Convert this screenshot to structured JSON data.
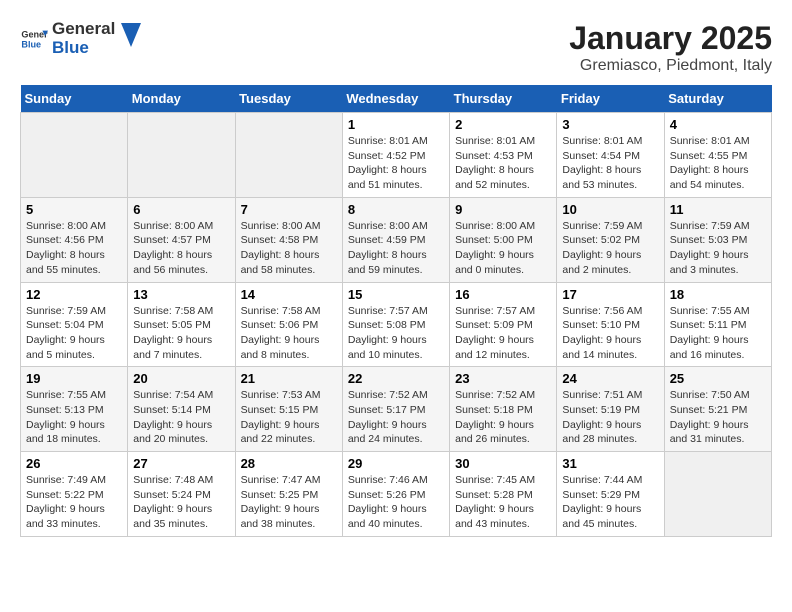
{
  "header": {
    "logo_general": "General",
    "logo_blue": "Blue",
    "title": "January 2025",
    "subtitle": "Gremiasco, Piedmont, Italy"
  },
  "days_of_week": [
    "Sunday",
    "Monday",
    "Tuesday",
    "Wednesday",
    "Thursday",
    "Friday",
    "Saturday"
  ],
  "weeks": [
    [
      {
        "day": "",
        "info": ""
      },
      {
        "day": "",
        "info": ""
      },
      {
        "day": "",
        "info": ""
      },
      {
        "day": "1",
        "info": "Sunrise: 8:01 AM\nSunset: 4:52 PM\nDaylight: 8 hours and 51 minutes."
      },
      {
        "day": "2",
        "info": "Sunrise: 8:01 AM\nSunset: 4:53 PM\nDaylight: 8 hours and 52 minutes."
      },
      {
        "day": "3",
        "info": "Sunrise: 8:01 AM\nSunset: 4:54 PM\nDaylight: 8 hours and 53 minutes."
      },
      {
        "day": "4",
        "info": "Sunrise: 8:01 AM\nSunset: 4:55 PM\nDaylight: 8 hours and 54 minutes."
      }
    ],
    [
      {
        "day": "5",
        "info": "Sunrise: 8:00 AM\nSunset: 4:56 PM\nDaylight: 8 hours and 55 minutes."
      },
      {
        "day": "6",
        "info": "Sunrise: 8:00 AM\nSunset: 4:57 PM\nDaylight: 8 hours and 56 minutes."
      },
      {
        "day": "7",
        "info": "Sunrise: 8:00 AM\nSunset: 4:58 PM\nDaylight: 8 hours and 58 minutes."
      },
      {
        "day": "8",
        "info": "Sunrise: 8:00 AM\nSunset: 4:59 PM\nDaylight: 8 hours and 59 minutes."
      },
      {
        "day": "9",
        "info": "Sunrise: 8:00 AM\nSunset: 5:00 PM\nDaylight: 9 hours and 0 minutes."
      },
      {
        "day": "10",
        "info": "Sunrise: 7:59 AM\nSunset: 5:02 PM\nDaylight: 9 hours and 2 minutes."
      },
      {
        "day": "11",
        "info": "Sunrise: 7:59 AM\nSunset: 5:03 PM\nDaylight: 9 hours and 3 minutes."
      }
    ],
    [
      {
        "day": "12",
        "info": "Sunrise: 7:59 AM\nSunset: 5:04 PM\nDaylight: 9 hours and 5 minutes."
      },
      {
        "day": "13",
        "info": "Sunrise: 7:58 AM\nSunset: 5:05 PM\nDaylight: 9 hours and 7 minutes."
      },
      {
        "day": "14",
        "info": "Sunrise: 7:58 AM\nSunset: 5:06 PM\nDaylight: 9 hours and 8 minutes."
      },
      {
        "day": "15",
        "info": "Sunrise: 7:57 AM\nSunset: 5:08 PM\nDaylight: 9 hours and 10 minutes."
      },
      {
        "day": "16",
        "info": "Sunrise: 7:57 AM\nSunset: 5:09 PM\nDaylight: 9 hours and 12 minutes."
      },
      {
        "day": "17",
        "info": "Sunrise: 7:56 AM\nSunset: 5:10 PM\nDaylight: 9 hours and 14 minutes."
      },
      {
        "day": "18",
        "info": "Sunrise: 7:55 AM\nSunset: 5:11 PM\nDaylight: 9 hours and 16 minutes."
      }
    ],
    [
      {
        "day": "19",
        "info": "Sunrise: 7:55 AM\nSunset: 5:13 PM\nDaylight: 9 hours and 18 minutes."
      },
      {
        "day": "20",
        "info": "Sunrise: 7:54 AM\nSunset: 5:14 PM\nDaylight: 9 hours and 20 minutes."
      },
      {
        "day": "21",
        "info": "Sunrise: 7:53 AM\nSunset: 5:15 PM\nDaylight: 9 hours and 22 minutes."
      },
      {
        "day": "22",
        "info": "Sunrise: 7:52 AM\nSunset: 5:17 PM\nDaylight: 9 hours and 24 minutes."
      },
      {
        "day": "23",
        "info": "Sunrise: 7:52 AM\nSunset: 5:18 PM\nDaylight: 9 hours and 26 minutes."
      },
      {
        "day": "24",
        "info": "Sunrise: 7:51 AM\nSunset: 5:19 PM\nDaylight: 9 hours and 28 minutes."
      },
      {
        "day": "25",
        "info": "Sunrise: 7:50 AM\nSunset: 5:21 PM\nDaylight: 9 hours and 31 minutes."
      }
    ],
    [
      {
        "day": "26",
        "info": "Sunrise: 7:49 AM\nSunset: 5:22 PM\nDaylight: 9 hours and 33 minutes."
      },
      {
        "day": "27",
        "info": "Sunrise: 7:48 AM\nSunset: 5:24 PM\nDaylight: 9 hours and 35 minutes."
      },
      {
        "day": "28",
        "info": "Sunrise: 7:47 AM\nSunset: 5:25 PM\nDaylight: 9 hours and 38 minutes."
      },
      {
        "day": "29",
        "info": "Sunrise: 7:46 AM\nSunset: 5:26 PM\nDaylight: 9 hours and 40 minutes."
      },
      {
        "day": "30",
        "info": "Sunrise: 7:45 AM\nSunset: 5:28 PM\nDaylight: 9 hours and 43 minutes."
      },
      {
        "day": "31",
        "info": "Sunrise: 7:44 AM\nSunset: 5:29 PM\nDaylight: 9 hours and 45 minutes."
      },
      {
        "day": "",
        "info": ""
      }
    ]
  ]
}
